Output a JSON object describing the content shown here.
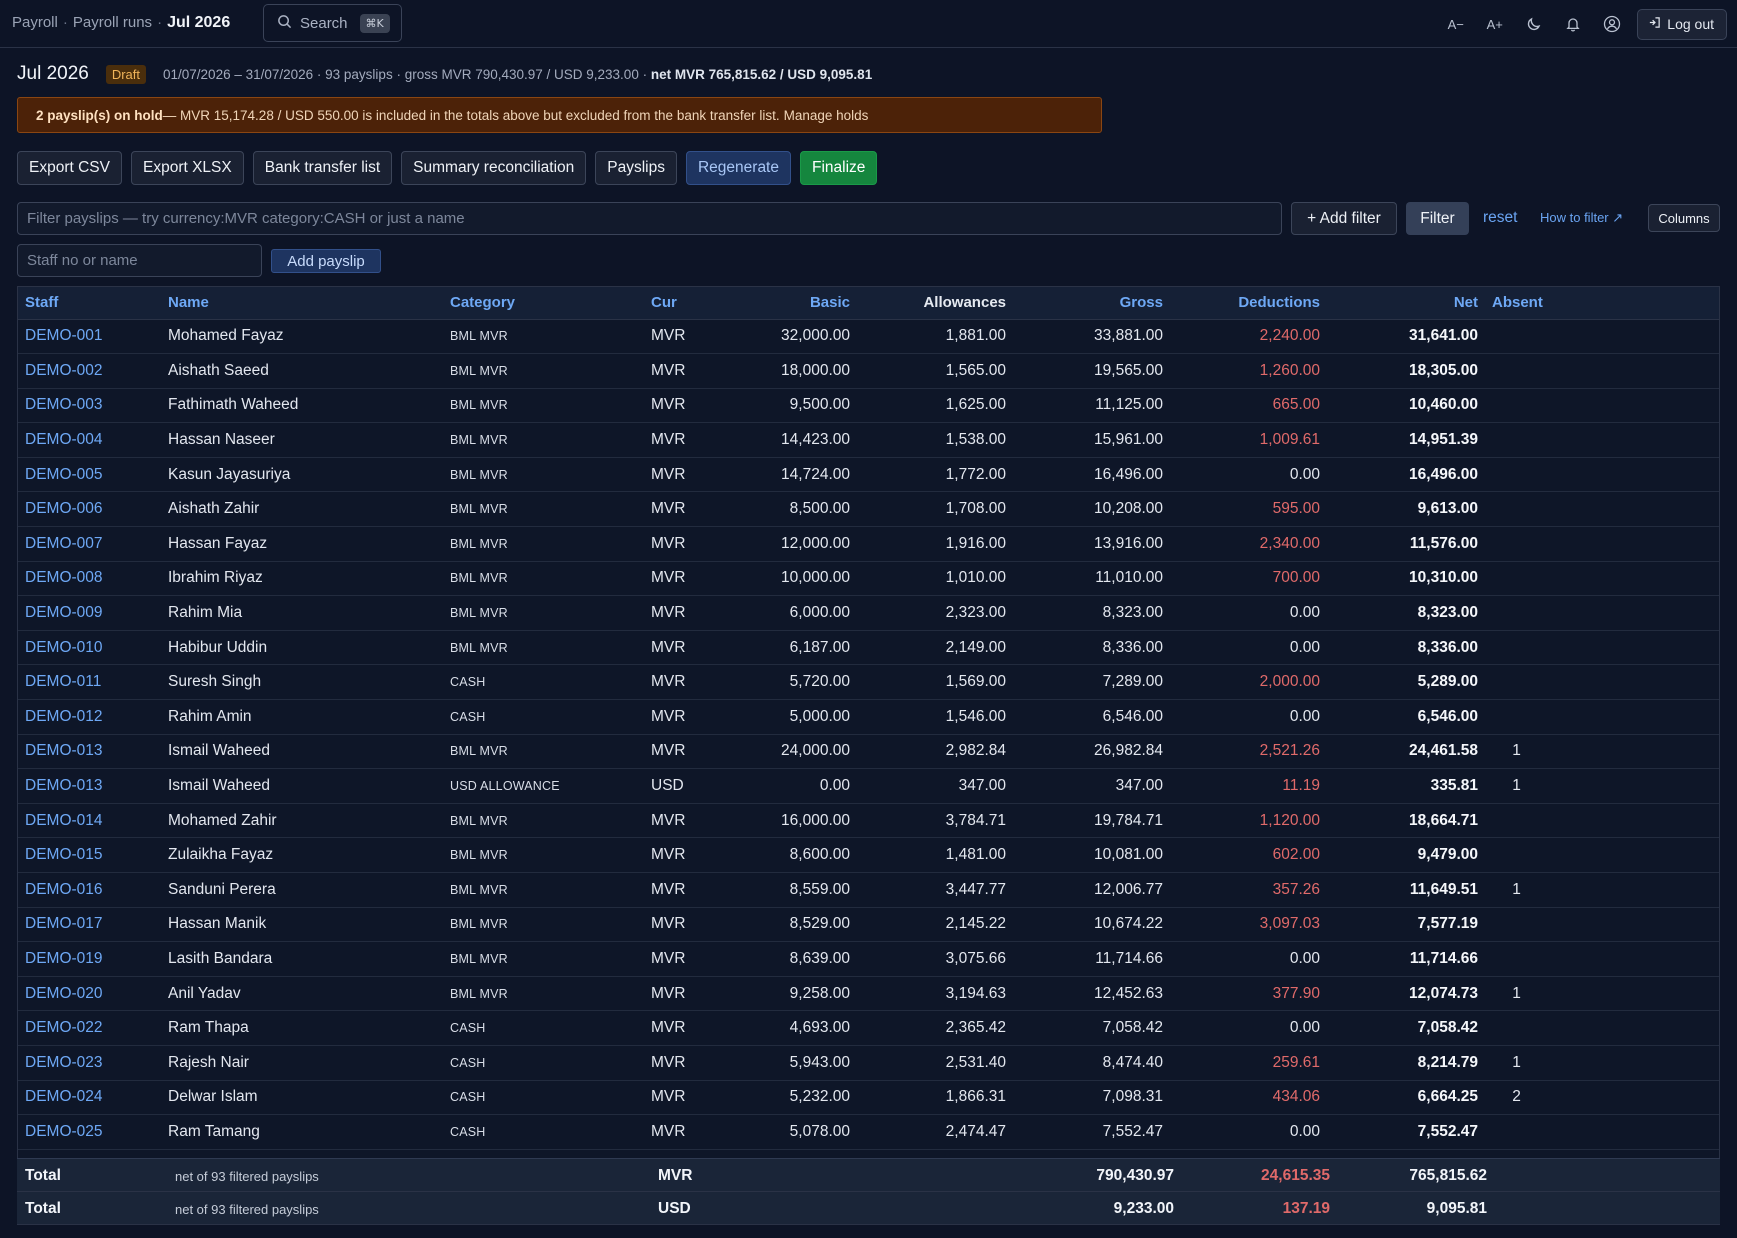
{
  "breadcrumb": [
    "Payroll",
    "Payroll runs",
    "Jul 2026"
  ],
  "search": {
    "label": "Search",
    "shortcut": "⌘K"
  },
  "topbar": {
    "font_smaller": "A−",
    "font_larger": "A+",
    "logout": "Log out"
  },
  "run": {
    "title": "Jul 2026",
    "status": "Draft",
    "meta_prefix": "01/07/2026 – 31/07/2026 · 93 payslips · gross MVR 790,430.97 / USD 9,233.00 · ",
    "meta_net": "net MVR 765,815.62 / USD 9,095.81"
  },
  "warning": {
    "bold": "2 payslip(s) on hold",
    "text": " — MVR 15,174.28 / USD 550.00 is included in the totals above but excluded from the bank transfer list.",
    "link": "Manage holds"
  },
  "actions": [
    "Export CSV",
    "Export XLSX",
    "Bank transfer list",
    "Summary reconciliation",
    "Payslips",
    "Regenerate",
    "Finalize"
  ],
  "filter": {
    "placeholder": "Filter payslips — try currency:MVR category:CASH or just a name",
    "add_filter": "+ Add filter",
    "filter": "Filter",
    "reset": "reset",
    "how": "How to filter ↗",
    "columns": "Columns"
  },
  "add": {
    "placeholder": "Staff no or name",
    "button": "Add payslip"
  },
  "columns": [
    "Staff",
    "Name",
    "Category",
    "Cur",
    "Basic",
    "Allowances",
    "Gross",
    "Deductions",
    "Net",
    "Absent"
  ],
  "rows": [
    [
      "DEMO-001",
      "Mohamed Fayaz",
      "BML MVR",
      "MVR",
      "32,000.00",
      "1,881.00",
      "33,881.00",
      "2,240.00",
      "31,641.00",
      ""
    ],
    [
      "DEMO-002",
      "Aishath Saeed",
      "BML MVR",
      "MVR",
      "18,000.00",
      "1,565.00",
      "19,565.00",
      "1,260.00",
      "18,305.00",
      ""
    ],
    [
      "DEMO-003",
      "Fathimath Waheed",
      "BML MVR",
      "MVR",
      "9,500.00",
      "1,625.00",
      "11,125.00",
      "665.00",
      "10,460.00",
      ""
    ],
    [
      "DEMO-004",
      "Hassan Naseer",
      "BML MVR",
      "MVR",
      "14,423.00",
      "1,538.00",
      "15,961.00",
      "1,009.61",
      "14,951.39",
      ""
    ],
    [
      "DEMO-005",
      "Kasun Jayasuriya",
      "BML MVR",
      "MVR",
      "14,724.00",
      "1,772.00",
      "16,496.00",
      "0.00",
      "16,496.00",
      ""
    ],
    [
      "DEMO-006",
      "Aishath Zahir",
      "BML MVR",
      "MVR",
      "8,500.00",
      "1,708.00",
      "10,208.00",
      "595.00",
      "9,613.00",
      ""
    ],
    [
      "DEMO-007",
      "Hassan Fayaz",
      "BML MVR",
      "MVR",
      "12,000.00",
      "1,916.00",
      "13,916.00",
      "2,340.00",
      "11,576.00",
      ""
    ],
    [
      "DEMO-008",
      "Ibrahim Riyaz",
      "BML MVR",
      "MVR",
      "10,000.00",
      "1,010.00",
      "11,010.00",
      "700.00",
      "10,310.00",
      ""
    ],
    [
      "DEMO-009",
      "Rahim Mia",
      "BML MVR",
      "MVR",
      "6,000.00",
      "2,323.00",
      "8,323.00",
      "0.00",
      "8,323.00",
      ""
    ],
    [
      "DEMO-010",
      "Habibur Uddin",
      "BML MVR",
      "MVR",
      "6,187.00",
      "2,149.00",
      "8,336.00",
      "0.00",
      "8,336.00",
      ""
    ],
    [
      "DEMO-011",
      "Suresh Singh",
      "CASH",
      "MVR",
      "5,720.00",
      "1,569.00",
      "7,289.00",
      "2,000.00",
      "5,289.00",
      ""
    ],
    [
      "DEMO-012",
      "Rahim Amin",
      "CASH",
      "MVR",
      "5,000.00",
      "1,546.00",
      "6,546.00",
      "0.00",
      "6,546.00",
      ""
    ],
    [
      "DEMO-013",
      "Ismail Waheed",
      "BML MVR",
      "MVR",
      "24,000.00",
      "2,982.84",
      "26,982.84",
      "2,521.26",
      "24,461.58",
      "1"
    ],
    [
      "DEMO-013",
      "Ismail Waheed",
      "USD ALLOWANCE",
      "USD",
      "0.00",
      "347.00",
      "347.00",
      "11.19",
      "335.81",
      "1"
    ],
    [
      "DEMO-014",
      "Mohamed Zahir",
      "BML MVR",
      "MVR",
      "16,000.00",
      "3,784.71",
      "19,784.71",
      "1,120.00",
      "18,664.71",
      ""
    ],
    [
      "DEMO-015",
      "Zulaikha Fayaz",
      "BML MVR",
      "MVR",
      "8,600.00",
      "1,481.00",
      "10,081.00",
      "602.00",
      "9,479.00",
      ""
    ],
    [
      "DEMO-016",
      "Sanduni Perera",
      "BML MVR",
      "MVR",
      "8,559.00",
      "3,447.77",
      "12,006.77",
      "357.26",
      "11,649.51",
      "1"
    ],
    [
      "DEMO-017",
      "Hassan Manik",
      "BML MVR",
      "MVR",
      "8,529.00",
      "2,145.22",
      "10,674.22",
      "3,097.03",
      "7,577.19",
      ""
    ],
    [
      "DEMO-019",
      "Lasith Bandara",
      "BML MVR",
      "MVR",
      "8,639.00",
      "3,075.66",
      "11,714.66",
      "0.00",
      "11,714.66",
      ""
    ],
    [
      "DEMO-020",
      "Anil Yadav",
      "BML MVR",
      "MVR",
      "9,258.00",
      "3,194.63",
      "12,452.63",
      "377.90",
      "12,074.73",
      "1"
    ],
    [
      "DEMO-022",
      "Ram Thapa",
      "CASH",
      "MVR",
      "4,693.00",
      "2,365.42",
      "7,058.42",
      "0.00",
      "7,058.42",
      ""
    ],
    [
      "DEMO-023",
      "Rajesh Nair",
      "CASH",
      "MVR",
      "5,943.00",
      "2,531.40",
      "8,474.40",
      "259.61",
      "8,214.79",
      "1"
    ],
    [
      "DEMO-024",
      "Delwar Islam",
      "CASH",
      "MVR",
      "5,232.00",
      "1,866.31",
      "7,098.31",
      "434.06",
      "6,664.25",
      "2"
    ],
    [
      "DEMO-025",
      "Ram Tamang",
      "CASH",
      "MVR",
      "5,078.00",
      "2,474.47",
      "7,552.47",
      "0.00",
      "7,552.47",
      ""
    ]
  ],
  "totals": [
    {
      "label": "Total",
      "note": "net of 93 filtered payslips",
      "cur": "MVR",
      "gross": "790,430.97",
      "deductions": "24,615.35",
      "net": "765,815.62"
    },
    {
      "label": "Total",
      "note": "net of 93 filtered payslips",
      "cur": "USD",
      "gross": "9,233.00",
      "deductions": "137.19",
      "net": "9,095.81"
    }
  ]
}
